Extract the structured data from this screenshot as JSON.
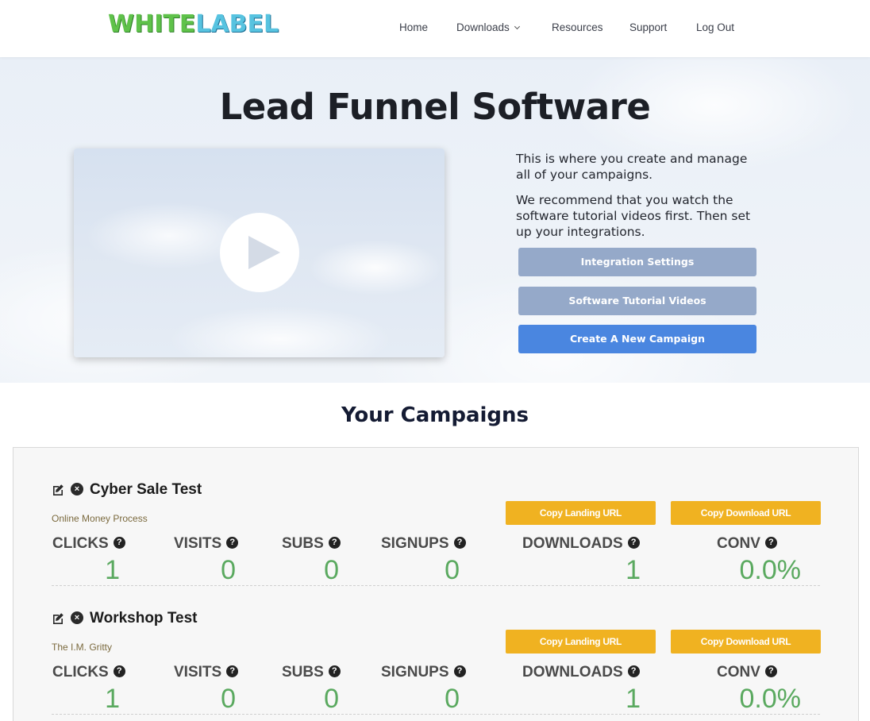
{
  "brand": {
    "logo_part1": "WHITE",
    "logo_part2": "LABEL"
  },
  "nav": {
    "items": [
      {
        "label": "Home"
      },
      {
        "label": "Downloads"
      },
      {
        "label": "Resources"
      },
      {
        "label": "Support"
      },
      {
        "label": "Log Out"
      }
    ]
  },
  "hero": {
    "title": "Lead Funnel Software",
    "paragraph1": "This is where you create and manage all of your campaigns.",
    "paragraph2": "We recommend that you watch the software tutorial videos first. Then set up your integrations.",
    "buttons": {
      "integration": "Integration Settings",
      "tutorial": "Software Tutorial Videos",
      "create": "Create A New Campaign"
    }
  },
  "campaigns_section": {
    "title": "Your Campaigns",
    "stat_labels": {
      "clicks": "CLICKS",
      "visits": "VISITS",
      "subs": "SUBS",
      "signups": "SIGNUPS",
      "downloads": "DOWNLOADS",
      "conv": "CONV"
    },
    "copy_landing_label": "Copy Landing URL",
    "copy_download_label": "Copy Download URL",
    "help_glyph": "?",
    "delete_glyph": "×",
    "campaigns": [
      {
        "name": "Cyber Sale Test",
        "subtitle": "Online Money Process",
        "clicks": "1",
        "visits": "0",
        "subs": "0",
        "signups": "0",
        "downloads": "1",
        "conv": "0.0%"
      },
      {
        "name": "Workshop Test",
        "subtitle": "The I.M. Gritty",
        "clicks": "1",
        "visits": "0",
        "subs": "0",
        "signups": "0",
        "downloads": "1",
        "conv": "0.0%"
      }
    ]
  },
  "colors": {
    "primary_button": "#4a86e0",
    "muted_button": "#95a9c9",
    "copy_button": "#f0b221",
    "stat_value": "#5aa95f"
  }
}
